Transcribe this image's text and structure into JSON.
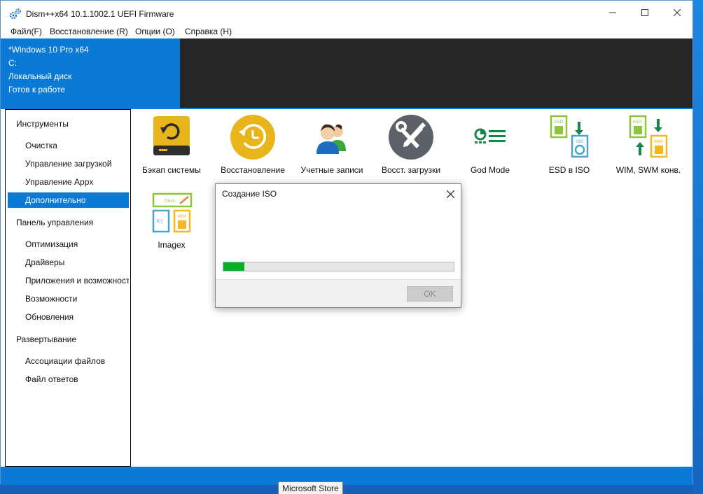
{
  "window": {
    "title": "Dism++x64 10.1.1002.1 UEFI Firmware",
    "minimize": "—",
    "maximize": "☐",
    "close": "✕"
  },
  "menu": [
    "Файл(F)",
    "Восстановление (R)",
    "Опции (O)",
    "Справка (H)"
  ],
  "info": {
    "edition": "*Windows 10 Pro x64",
    "drive": "C:",
    "disk": "Локальный диск",
    "status": "Готов к работе"
  },
  "sidebar": {
    "sections": [
      {
        "title": "Инструменты",
        "items": [
          "Очистка",
          "Управление загрузкой",
          "Управление Appx",
          "Дополнительно"
        ]
      },
      {
        "title": "Панель управления",
        "items": [
          "Оптимизация",
          "Драйверы",
          "Приложения и возможности",
          "Возможности",
          "Обновления"
        ]
      },
      {
        "title": "Развертывание",
        "items": [
          "Ассоциации файлов",
          "Файл ответов"
        ]
      }
    ],
    "active_item": "Дополнительно"
  },
  "tools": [
    {
      "label": "Бэкап системы",
      "icon": "backup-drive-icon"
    },
    {
      "label": "Восстановление",
      "icon": "restore-clock-icon"
    },
    {
      "label": "Учетные записи",
      "icon": "users-icon"
    },
    {
      "label": "Восст. загрузки",
      "icon": "boot-repair-tools-icon"
    },
    {
      "label": "God Mode",
      "icon": "god-mode-icon"
    },
    {
      "label": "ESD в ISO",
      "icon": "esd-to-iso-icon"
    },
    {
      "label": "WIM, SWM конв.",
      "icon": "wim-swm-convert-icon"
    },
    {
      "label": "Imagex",
      "icon": "imagex-icon"
    }
  ],
  "icon_text": {
    "esd": "ESD",
    "iso": "ISO",
    "wim": "WIM",
    "drive": "X:\\",
    "dism": "Dism"
  },
  "dialog": {
    "title": "Создание ISO",
    "close": "✕",
    "progress_percent": 9,
    "ok_label": "OK",
    "ok_enabled": false
  },
  "tooltip": "Microsoft Store",
  "colors": {
    "accent": "#0b7ad7",
    "info_dark": "#262626",
    "progress": "#06b025"
  }
}
